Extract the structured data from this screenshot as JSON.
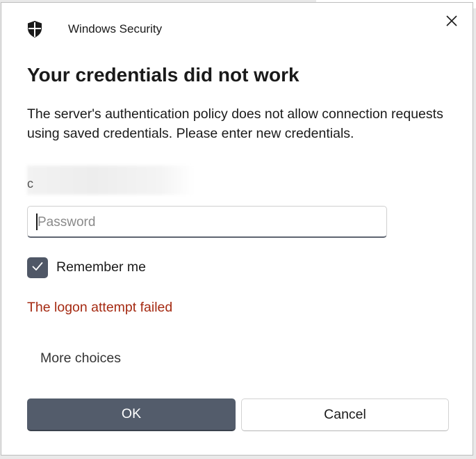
{
  "window": {
    "title": "Windows Security",
    "close_icon": "close-icon",
    "shield_icon": "shield-icon"
  },
  "dialog": {
    "heading": "Your credentials did not work",
    "description": "The server's authentication policy does not allow connection requests using saved credentials. Please enter new credentials.",
    "username_visible_char": "c"
  },
  "password": {
    "placeholder": "Password",
    "value": ""
  },
  "remember_me": {
    "label": "Remember me",
    "checked": true
  },
  "error": {
    "message": "The logon attempt failed",
    "color": "#a52a12"
  },
  "links": {
    "more_choices": "More choices"
  },
  "buttons": {
    "ok": "OK",
    "cancel": "Cancel"
  },
  "colors": {
    "primary_button": "#535c6b",
    "checkbox": "#4f5766"
  }
}
